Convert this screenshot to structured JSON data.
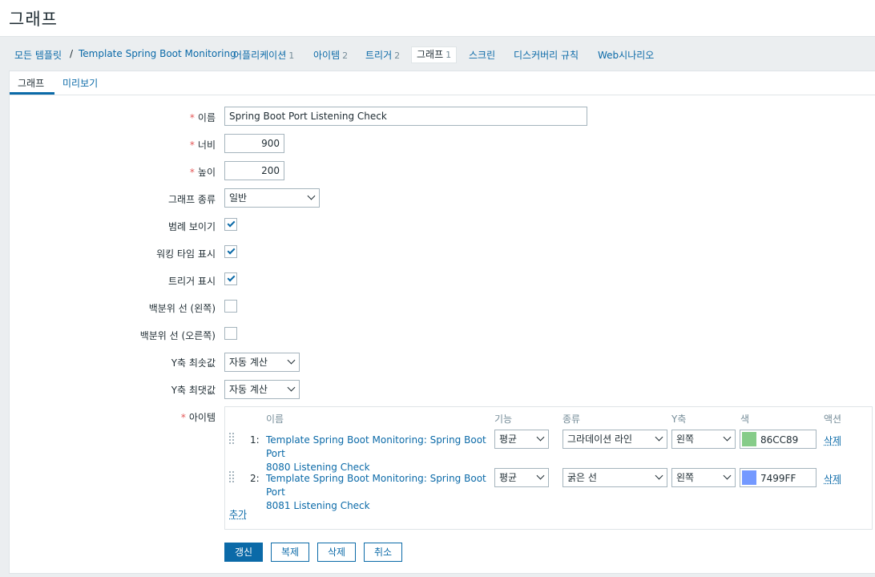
{
  "page": {
    "title": "그래프"
  },
  "breadcrumb": {
    "all_templates": "모든 템플릿",
    "separator": "/",
    "template_name": "Template Spring Boot Monitoring",
    "applications": {
      "label": "어플리케이션",
      "count": "1"
    },
    "items": {
      "label": "아이템",
      "count": "2"
    },
    "triggers": {
      "label": "트리거",
      "count": "2"
    },
    "graphs": {
      "label": "그래프",
      "count": "1"
    },
    "screens": {
      "label": "스크린"
    },
    "discovery": {
      "label": "디스커버리 규칙"
    },
    "web": {
      "label": "Web시나리오"
    }
  },
  "tabs": {
    "graph": "그래프",
    "preview": "미리보기"
  },
  "form": {
    "required_mark": "*",
    "name": {
      "label": "이름",
      "value": "Spring Boot Port Listening Check"
    },
    "width": {
      "label": "너비",
      "value": "900"
    },
    "height": {
      "label": "높이",
      "value": "200"
    },
    "graph_type": {
      "label": "그래프 종류",
      "value": "일반"
    },
    "show_legend": {
      "label": "범례 보이기",
      "checked": true
    },
    "show_working_time": {
      "label": "워킹 타임 표시",
      "checked": true
    },
    "show_triggers": {
      "label": "트리거 표시",
      "checked": true
    },
    "percentile_left": {
      "label": "백분위 선 (왼쪽)",
      "checked": false
    },
    "percentile_right": {
      "label": "백분위 선 (오른쪽)",
      "checked": false
    },
    "y_min": {
      "label": "Y축 최솟값",
      "value": "자동 계산"
    },
    "y_max": {
      "label": "Y축 최댓값",
      "value": "자동 계산"
    },
    "items_label": "아이템"
  },
  "items_table": {
    "headers": {
      "name": "이름",
      "function": "기능",
      "type": "종류",
      "yaxis": "Y축",
      "color": "색",
      "action": "액션"
    },
    "rows": [
      {
        "num": "1:",
        "name_line1": "Template Spring Boot Monitoring: Spring Boot Port",
        "name_line2": "8080 Listening Check",
        "function": "평균",
        "type": "그라데이션 라인",
        "yaxis": "왼쪽",
        "color": "86CC89",
        "color_hex": "#86CC89",
        "action": "삭제"
      },
      {
        "num": "2:",
        "name_line1": "Template Spring Boot Monitoring: Spring Boot Port",
        "name_line2": "8081 Listening Check",
        "function": "평균",
        "type": "굵은 선",
        "yaxis": "왼쪽",
        "color": "7499FF",
        "color_hex": "#7499FF",
        "action": "삭제"
      }
    ],
    "add": "추가"
  },
  "buttons": {
    "update": "갱신",
    "clone": "복제",
    "delete": "삭제",
    "cancel": "취소"
  },
  "colors": {
    "link": "#0b6aa8",
    "required": "#e45959"
  }
}
